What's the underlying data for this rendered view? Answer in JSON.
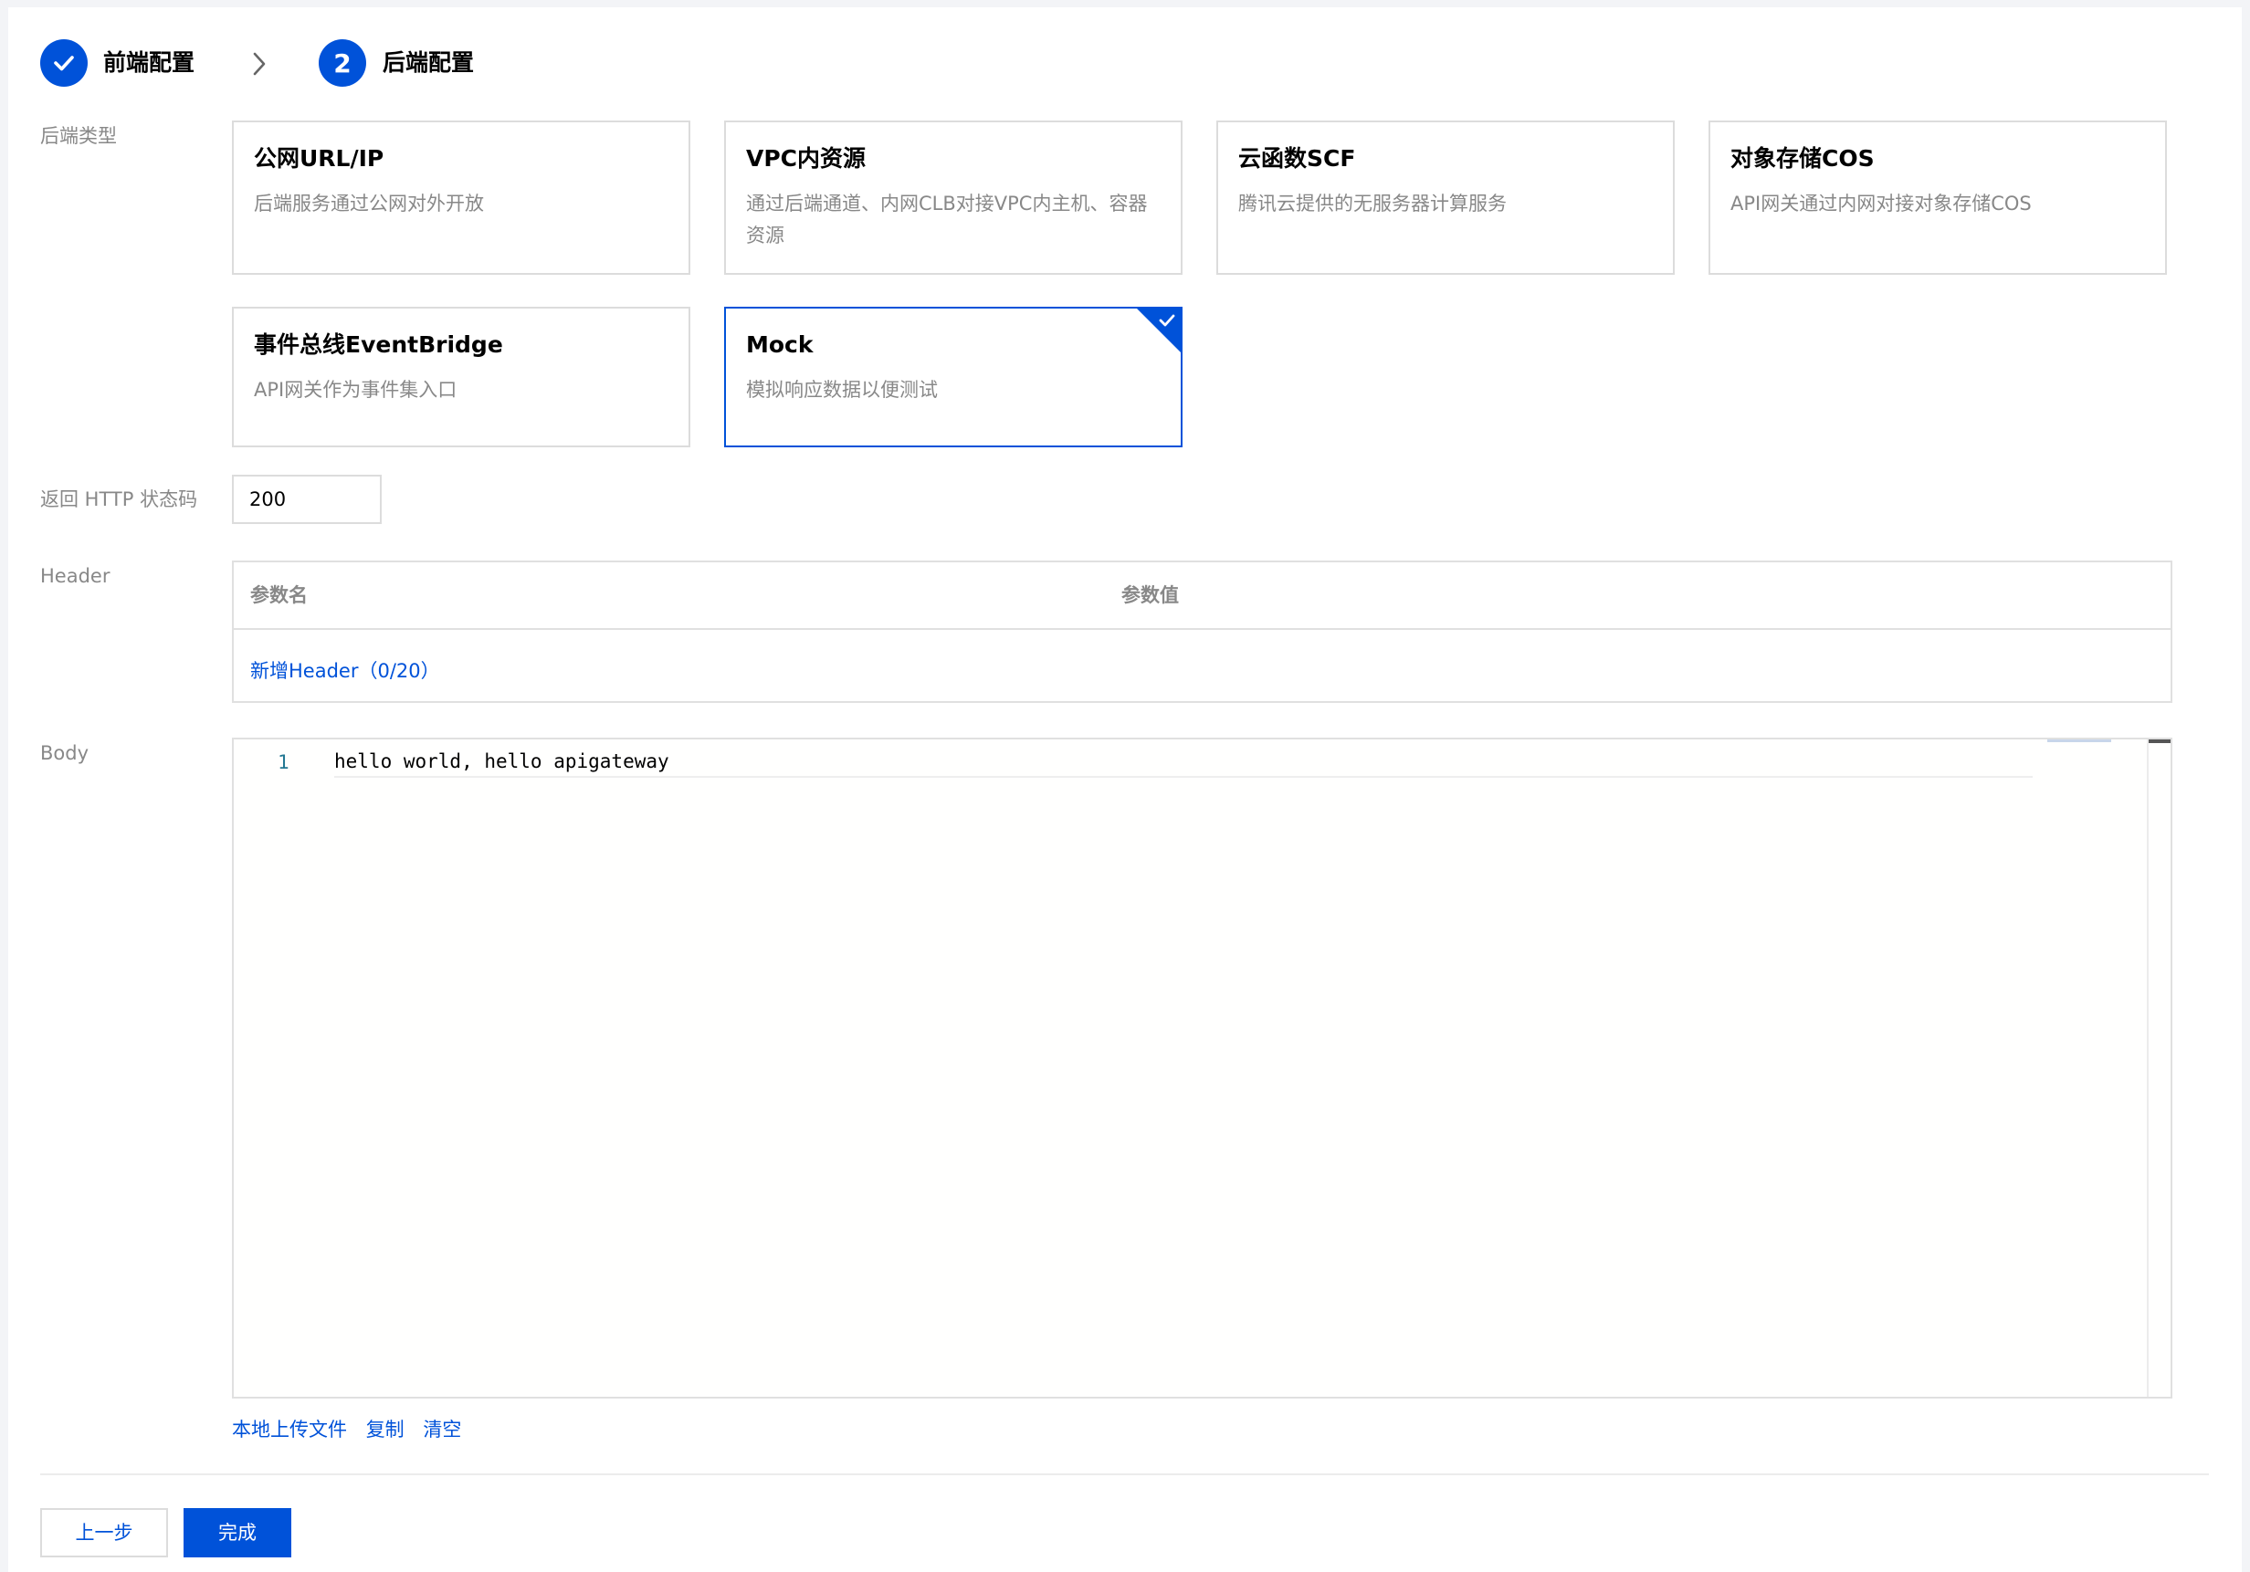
{
  "steps": [
    {
      "label": "前端配置",
      "state": "done",
      "icon": "check-icon"
    },
    {
      "label": "后端配置",
      "state": "current",
      "number": "2"
    }
  ],
  "form": {
    "backend_type_label": "后端类型",
    "backend_types": [
      {
        "title": "公网URL/IP",
        "desc": "后端服务通过公网对外开放"
      },
      {
        "title": "VPC内资源",
        "desc": "通过后端通道、内网CLB对接VPC内主机、容器资源"
      },
      {
        "title": "云函数SCF",
        "desc": "腾讯云提供的无服务器计算服务"
      },
      {
        "title": "对象存储COS",
        "desc": "API网关通过内网对接对象存储COS"
      },
      {
        "title": "事件总线EventBridge",
        "desc": "API网关作为事件集入口"
      },
      {
        "title": "Mock",
        "desc": "模拟响应数据以便测试",
        "selected": true
      }
    ],
    "status_code_label": "返回 HTTP 状态码",
    "status_code_value": "200",
    "header_label": "Header",
    "header_table": {
      "col_name": "参数名",
      "col_value": "参数值",
      "add_link": "新增Header（0/20）"
    },
    "body_label": "Body",
    "editor": {
      "line_number": "1",
      "code": "hello world, hello apigateway"
    },
    "body_actions": {
      "upload": "本地上传文件",
      "copy": "复制",
      "clear": "清空"
    }
  },
  "footer": {
    "prev_button": "上一步",
    "finish_button": "完成"
  },
  "colors": {
    "primary": "#0052d9",
    "muted_text": "#888888",
    "border": "#dcdcdc"
  }
}
